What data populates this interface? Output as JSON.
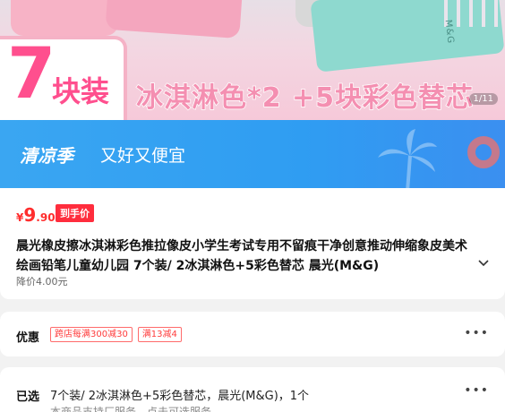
{
  "hero": {
    "pack_number": "7",
    "pack_unit": "块装",
    "slogan": "冰淇淋色*2 +5块彩色替芯",
    "brand_stamp": "M&G",
    "page_indicator": "1/11"
  },
  "promo": {
    "name": "清凉季",
    "tagline": "又好又便宜"
  },
  "product": {
    "price_currency": "¥",
    "price_integer": "9",
    "price_decimal": ".90",
    "price_tag": "到手价",
    "title": "晨光橡皮擦冰淇淋彩色推拉像皮小学生考试专用不留痕干净创意推动伸缩象皮美术绘画铅笔儿童幼儿园 7个装/ 2冰淇淋色+5彩色替芯 晨光(M&G)",
    "expand_icon": "chevron-down-icon",
    "sub_price": "降价4.00元"
  },
  "offers": {
    "label": "优惠",
    "coupons": [
      "跨店每满300减30",
      "满13减4"
    ],
    "more": "•••"
  },
  "selected": {
    "label": "已选",
    "text": "7个装/ 2冰淇淋色+5彩色替芯，晨光(M&G)，1个",
    "note": "本商品支持厂服务，点击可选服务",
    "more": "•••"
  },
  "colors": {
    "price_red": "#ff2d2d",
    "promo_blue": "#2f9df2",
    "hero_pink": "#ff4f8e"
  }
}
